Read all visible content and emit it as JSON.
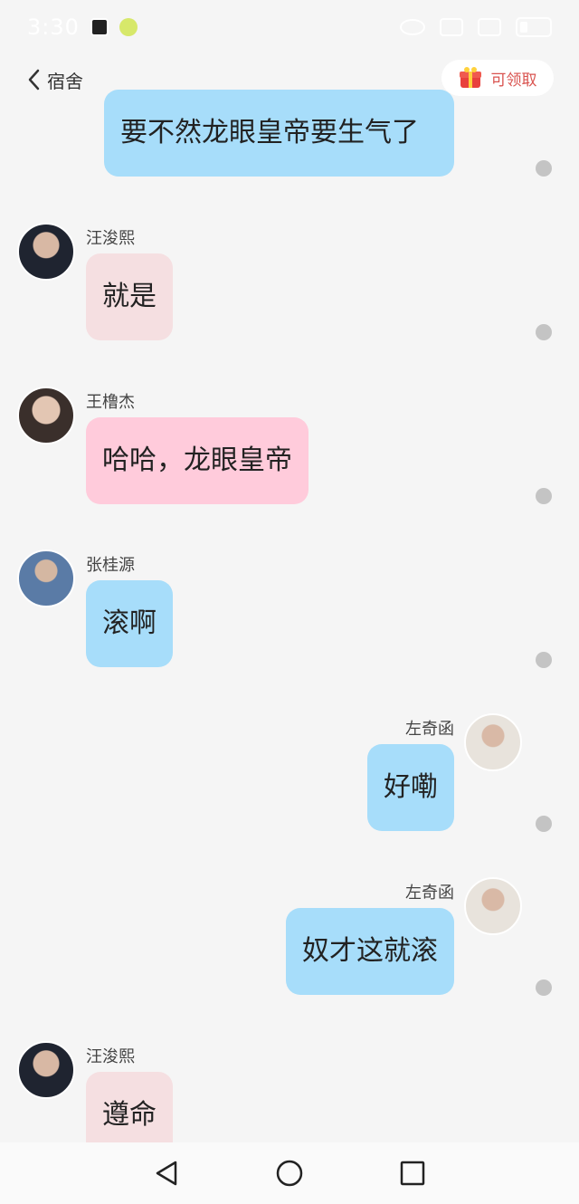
{
  "status_bar": {
    "time": "3:30"
  },
  "header": {
    "back_label": "宿舍",
    "reward_label": "可领取"
  },
  "messages": [
    {
      "sender": "",
      "text": "要不然龙眼皇帝要生气了",
      "side": "right"
    },
    {
      "sender": "汪浚熙",
      "text": "就是",
      "side": "left"
    },
    {
      "sender": "王橹杰",
      "text": "哈哈，龙眼皇帝",
      "side": "left"
    },
    {
      "sender": "张桂源",
      "text": "滚啊",
      "side": "left"
    },
    {
      "sender": "左奇函",
      "text": "好嘞",
      "side": "right"
    },
    {
      "sender": "左奇函",
      "text": "奴才这就滚",
      "side": "right"
    },
    {
      "sender": "汪浚熙",
      "text": "遵命",
      "side": "left"
    }
  ],
  "icons": {
    "back": "chevron-left-icon",
    "reward": "gift-icon",
    "nav_back": "triangle-back-icon",
    "nav_home": "circle-home-icon",
    "nav_recents": "square-recents-icon"
  },
  "colors": {
    "bubble_blue": "#a7ddfa",
    "bubble_light_pink": "#f5dfe1",
    "bubble_pink": "#ffcbdb",
    "reward_text": "#d9534f"
  }
}
